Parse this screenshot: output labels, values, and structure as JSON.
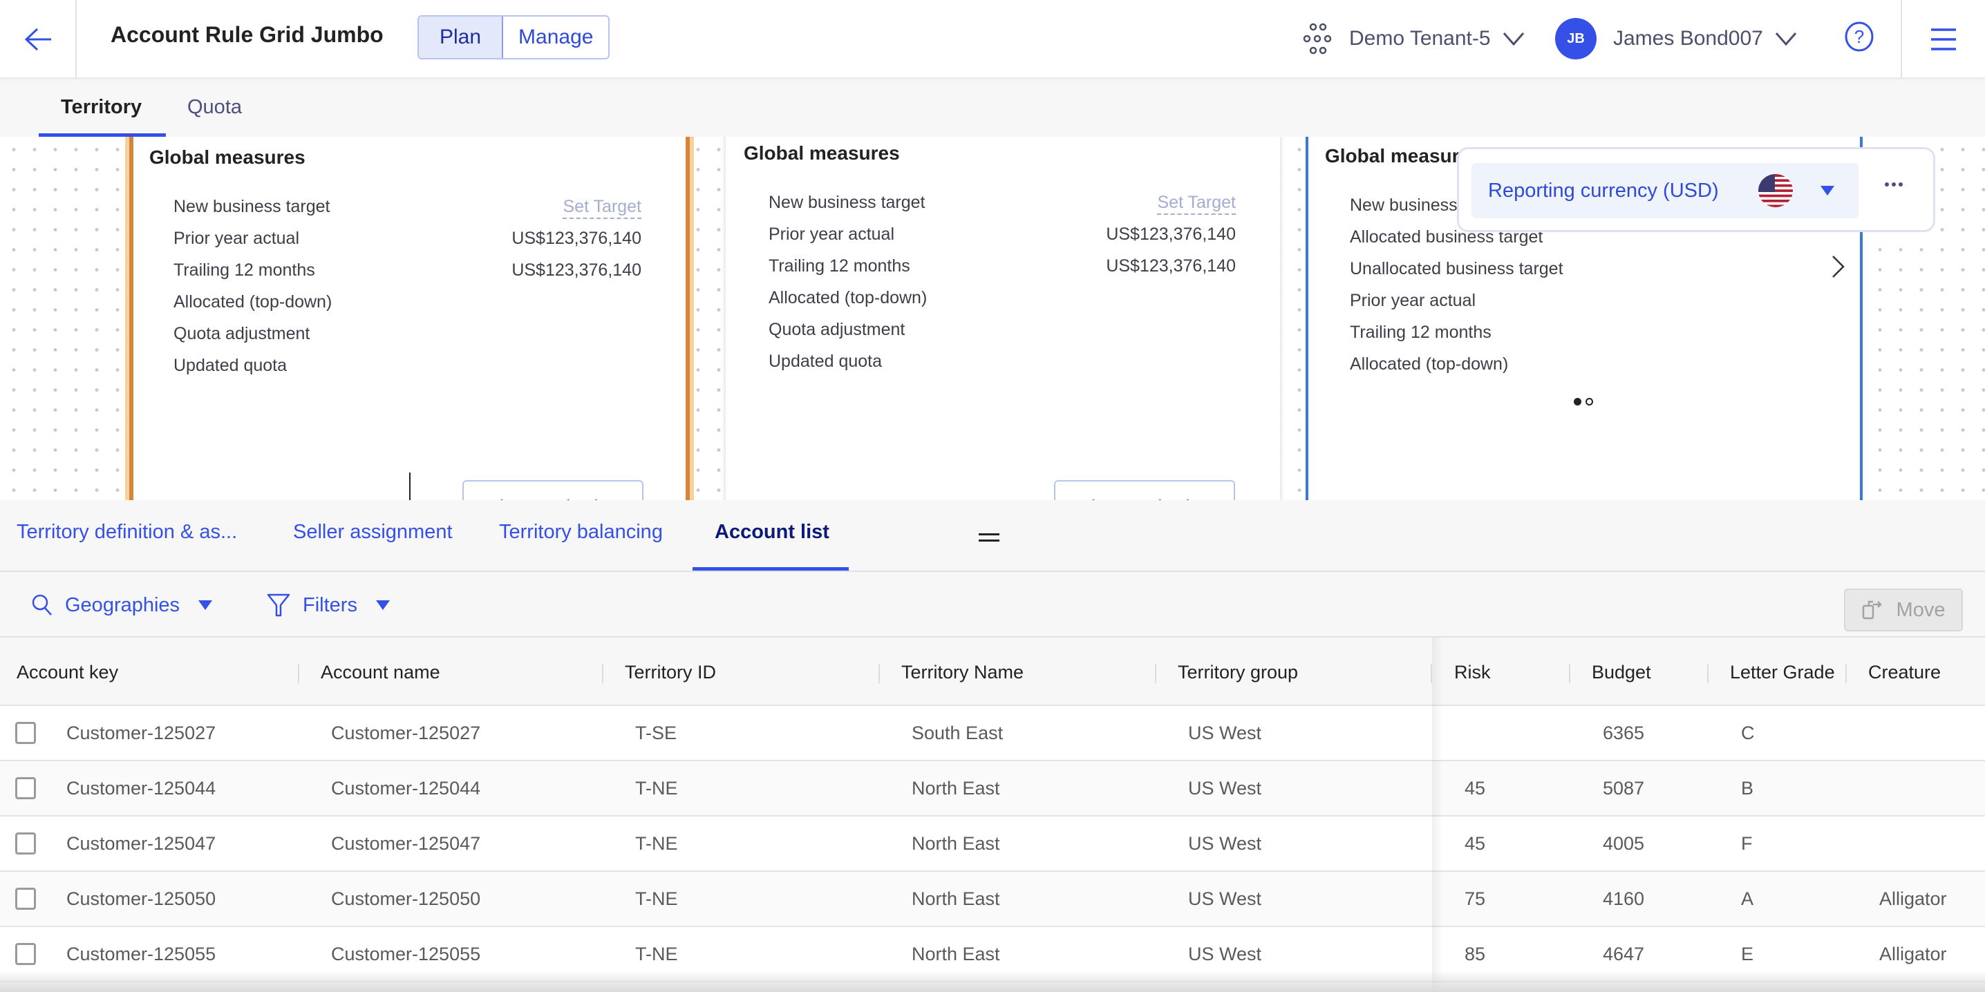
{
  "header": {
    "title": "Account Rule Grid Jumbo",
    "mode_toggle": [
      {
        "label": "Plan",
        "active": true
      },
      {
        "label": "Manage",
        "active": false
      }
    ],
    "tenant": "Demo Tenant-5",
    "user": {
      "initials": "JB",
      "name": "James Bond007"
    }
  },
  "subtabs": [
    {
      "label": "Territory",
      "active": true
    },
    {
      "label": "Quota",
      "active": false
    }
  ],
  "cards": [
    {
      "title": "Global measures",
      "highlight": "orange",
      "measures": [
        {
          "label": "New business target",
          "value": "Set Target",
          "is_link": true
        },
        {
          "label": "Prior year actual",
          "value": "US$123,376,140"
        },
        {
          "label": "Trailing 12 months",
          "value": "US$123,376,140"
        },
        {
          "label": "Allocated (top-down)",
          "value": ""
        },
        {
          "label": "Quota adjustment",
          "value": ""
        },
        {
          "label": "Updated quota",
          "value": ""
        }
      ],
      "button": "Plan Territories"
    },
    {
      "title": "Global measures",
      "measures": [
        {
          "label": "New business target",
          "value": "Set Target",
          "is_link": true
        },
        {
          "label": "Prior year actual",
          "value": "US$123,376,140"
        },
        {
          "label": "Trailing 12 months",
          "value": "US$123,376,140"
        },
        {
          "label": "Allocated (top-down)",
          "value": ""
        },
        {
          "label": "Quota adjustment",
          "value": ""
        },
        {
          "label": "Updated quota",
          "value": ""
        }
      ],
      "button": "Plan Territories"
    },
    {
      "title": "Global measures",
      "highlight": "blue",
      "measures": [
        {
          "label": "New business target"
        },
        {
          "label": "Allocated business target"
        },
        {
          "label": "Unallocated business target"
        },
        {
          "label": "Prior year actual"
        },
        {
          "label": "Trailing 12 months"
        },
        {
          "label": "Allocated (top-down)"
        }
      ],
      "pagination": {
        "current": 1,
        "total": 2
      }
    }
  ],
  "currency": {
    "label": "Reporting currency (USD)",
    "flag": "us-flag"
  },
  "tabs": [
    {
      "label": "Territory definition & as...",
      "active": false
    },
    {
      "label": "Seller assignment",
      "active": false
    },
    {
      "label": "Territory balancing",
      "active": false
    },
    {
      "label": "Account list",
      "active": true
    }
  ],
  "toolbar": {
    "geographies": "Geographies",
    "filters": "Filters",
    "move": "Move"
  },
  "table": {
    "columns": [
      "Account key",
      "Account name",
      "Territory ID",
      "Territory Name",
      "Territory group",
      "Risk",
      "Budget",
      "Letter Grade",
      "Creature"
    ],
    "rows": [
      [
        "Customer-125027",
        "Customer-125027",
        "T-SE",
        "South East",
        "US West",
        "",
        "6365",
        "C",
        ""
      ],
      [
        "Customer-125044",
        "Customer-125044",
        "T-NE",
        "North East",
        "US West",
        "45",
        "5087",
        "B",
        ""
      ],
      [
        "Customer-125047",
        "Customer-125047",
        "T-NE",
        "North East",
        "US West",
        "45",
        "4005",
        "F",
        ""
      ],
      [
        "Customer-125050",
        "Customer-125050",
        "T-NE",
        "North East",
        "US West",
        "75",
        "4160",
        "A",
        "Alligator"
      ],
      [
        "Customer-125055",
        "Customer-125055",
        "T-NE",
        "North East",
        "US West",
        "85",
        "4647",
        "E",
        "Alligator"
      ]
    ]
  },
  "colors": {
    "accent": "#3450e6",
    "selected_card": "#d9843a",
    "active_card": "#3a7ad6"
  }
}
